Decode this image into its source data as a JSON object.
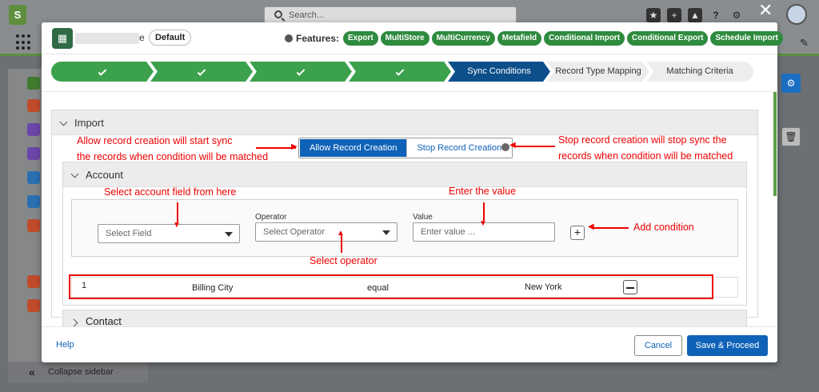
{
  "topbar": {
    "search_placeholder": "Search...",
    "notification_count": "+"
  },
  "sidebar": {
    "collapse_label": "Collapse sidebar"
  },
  "modal": {
    "store_name_suffix": "e",
    "default_badge": "Default",
    "features_label": "Features:",
    "features": [
      "Export",
      "MultiStore",
      "MultiCurrency",
      "Metafield",
      "Conditional Import",
      "Conditional Export",
      "Schedule Import"
    ],
    "steps": [
      {
        "label": "",
        "state": "done"
      },
      {
        "label": "",
        "state": "done"
      },
      {
        "label": "",
        "state": "done"
      },
      {
        "label": "",
        "state": "done"
      },
      {
        "label": "Sync Conditions",
        "state": "active"
      },
      {
        "label": "Record Type Mapping",
        "state": "todo"
      },
      {
        "label": "Matching Criteria",
        "state": "todo"
      }
    ],
    "import_section": {
      "title": "Import",
      "allow_button": "Allow Record Creation",
      "stop_button": "Stop Record Creation"
    },
    "account_section": {
      "title": "Account",
      "field_placeholder": "Select Field",
      "operator_label": "Operator",
      "operator_placeholder": "Select Operator",
      "value_label": "Value",
      "value_placeholder": "Enter value ...",
      "add_button": "+"
    },
    "condition_row": {
      "index": "1",
      "field": "Billing City",
      "operator": "equal",
      "value": "New York"
    },
    "contact_section": {
      "title": "Contact"
    },
    "footer": {
      "help": "Help",
      "cancel": "Cancel",
      "save": "Save & Proceed"
    }
  },
  "annotations": {
    "allow_line1": "Allow record creation will start sync",
    "allow_line2": "the records when condition will be matched",
    "stop_line1": "Stop record creation will stop sync the",
    "stop_line2": "records when condition will be matched",
    "select_field": "Select account field from here",
    "enter_value": "Enter the value",
    "add_condition": "Add condition",
    "select_operator": "Select operator"
  },
  "colors": {
    "accent": "#0f62b8",
    "success": "#3ba14d",
    "active_step": "#0d4f8b",
    "annotation": "#e00000"
  }
}
